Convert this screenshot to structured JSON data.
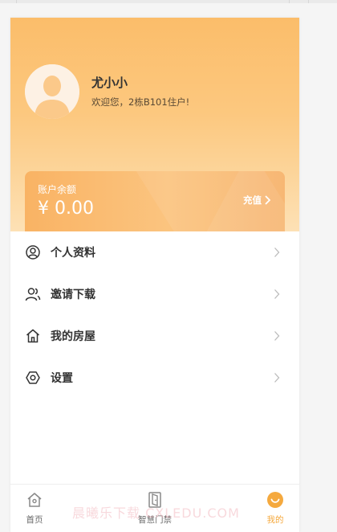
{
  "profile": {
    "username": "尤小小",
    "welcome": "欢迎您，2栋B101住户!"
  },
  "balance": {
    "label": "账户余额",
    "amount": "¥ 0.00",
    "recharge_label": "充值"
  },
  "menu": {
    "items": [
      {
        "label": "个人资料",
        "icon": "user-circle-icon"
      },
      {
        "label": "邀请下载",
        "icon": "users-icon"
      },
      {
        "label": "我的房屋",
        "icon": "house-icon"
      },
      {
        "label": "设置",
        "icon": "settings-icon"
      }
    ]
  },
  "tabbar": {
    "tabs": [
      {
        "label": "首页",
        "icon": "home-icon",
        "active": false
      },
      {
        "label": "智慧门禁",
        "icon": "door-icon",
        "active": false
      },
      {
        "label": "我的",
        "icon": "smile-icon",
        "active": true
      }
    ]
  },
  "watermark": "晨曦乐下载 CXLEDU.COM",
  "colors": {
    "accent": "#f5a93e",
    "header_top": "#fbbd6a",
    "header_bottom": "#fde1b5"
  }
}
